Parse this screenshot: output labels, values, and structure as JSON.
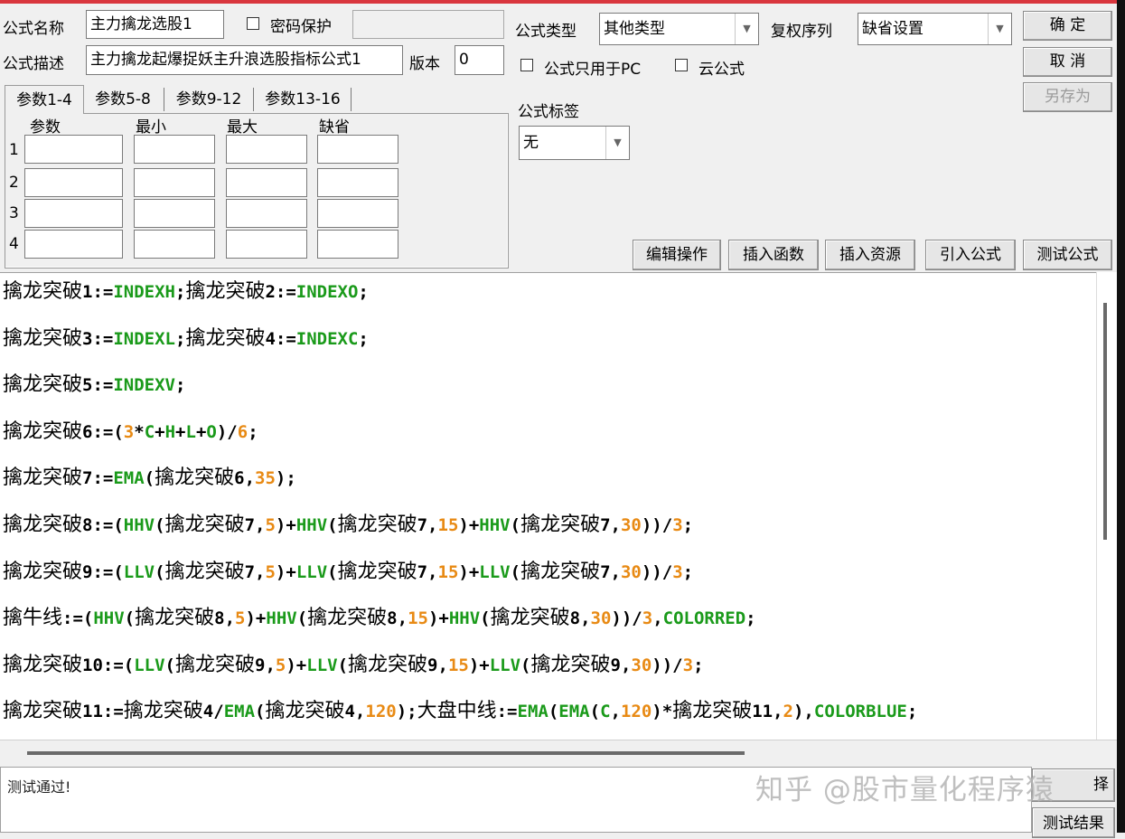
{
  "form": {
    "name_label": "公式名称",
    "name_value": "主力擒龙选股1",
    "password_label": "密码保护",
    "password_value": "",
    "desc_label": "公式描述",
    "desc_value": "主力擒龙起爆捉妖主升浪选股指标公式1",
    "version_label": "版本",
    "version_value": "0",
    "type_label": "公式类型",
    "type_value": "其他类型",
    "rights_label": "复权序列",
    "rights_value": "缺省设置",
    "pc_only_label": "公式只用于PC",
    "cloud_label": "云公式",
    "tag_label": "公式标签",
    "tag_value": "无"
  },
  "buttons": {
    "ok": "确  定",
    "cancel": "取  消",
    "save_as": "另存为",
    "edit_ops": "编辑操作",
    "insert_func": "插入函数",
    "insert_res": "插入资源",
    "import_formula": "引入公式",
    "test_formula": "测试公式",
    "select_partial": "择",
    "test_result": "测试结果"
  },
  "tabs": [
    "参数1-4",
    "参数5-8",
    "参数9-12",
    "参数13-16"
  ],
  "params": {
    "headers": [
      "参数",
      "最小",
      "最大",
      "缺省"
    ],
    "rows": [
      "1",
      "2",
      "3",
      "4"
    ]
  },
  "code": [
    [
      [
        "cjk",
        "擒龙突破"
      ],
      [
        "t",
        "1:="
      ],
      [
        "fn",
        "INDEXH"
      ],
      [
        "t",
        ";"
      ],
      [
        "cjk",
        "擒龙突破"
      ],
      [
        "t",
        "2:="
      ],
      [
        "fn",
        "INDEXO"
      ],
      [
        "t",
        ";"
      ]
    ],
    [
      [
        "cjk",
        "擒龙突破"
      ],
      [
        "t",
        "3:="
      ],
      [
        "fn",
        "INDEXL"
      ],
      [
        "t",
        ";"
      ],
      [
        "cjk",
        "擒龙突破"
      ],
      [
        "t",
        "4:="
      ],
      [
        "fn",
        "INDEXC"
      ],
      [
        "t",
        ";"
      ]
    ],
    [
      [
        "cjk",
        "擒龙突破"
      ],
      [
        "t",
        "5:="
      ],
      [
        "fn",
        "INDEXV"
      ],
      [
        "t",
        ";"
      ]
    ],
    [
      [
        "cjk",
        "擒龙突破"
      ],
      [
        "t",
        "6:=("
      ],
      [
        "num",
        "3"
      ],
      [
        "t",
        "*"
      ],
      [
        "fn",
        "C"
      ],
      [
        "t",
        "+"
      ],
      [
        "fn",
        "H"
      ],
      [
        "t",
        "+"
      ],
      [
        "fn",
        "L"
      ],
      [
        "t",
        "+"
      ],
      [
        "fn",
        "O"
      ],
      [
        "t",
        ")/"
      ],
      [
        "num",
        "6"
      ],
      [
        "t",
        ";"
      ]
    ],
    [
      [
        "cjk",
        "擒龙突破"
      ],
      [
        "t",
        "7:="
      ],
      [
        "fn",
        "EMA"
      ],
      [
        "t",
        "("
      ],
      [
        "cjk",
        "擒龙突破"
      ],
      [
        "t",
        "6,"
      ],
      [
        "num",
        "35"
      ],
      [
        "t",
        ");"
      ]
    ],
    [
      [
        "cjk",
        "擒龙突破"
      ],
      [
        "t",
        "8:=("
      ],
      [
        "fn",
        "HHV"
      ],
      [
        "t",
        "("
      ],
      [
        "cjk",
        "擒龙突破"
      ],
      [
        "t",
        "7,"
      ],
      [
        "num",
        "5"
      ],
      [
        "t",
        ")+"
      ],
      [
        "fn",
        "HHV"
      ],
      [
        "t",
        "("
      ],
      [
        "cjk",
        "擒龙突破"
      ],
      [
        "t",
        "7,"
      ],
      [
        "num",
        "15"
      ],
      [
        "t",
        ")+"
      ],
      [
        "fn",
        "HHV"
      ],
      [
        "t",
        "("
      ],
      [
        "cjk",
        "擒龙突破"
      ],
      [
        "t",
        "7,"
      ],
      [
        "num",
        "30"
      ],
      [
        "t",
        "))/"
      ],
      [
        "num",
        "3"
      ],
      [
        "t",
        ";"
      ]
    ],
    [
      [
        "cjk",
        "擒龙突破"
      ],
      [
        "t",
        "9:=("
      ],
      [
        "fn",
        "LLV"
      ],
      [
        "t",
        "("
      ],
      [
        "cjk",
        "擒龙突破"
      ],
      [
        "t",
        "7,"
      ],
      [
        "num",
        "5"
      ],
      [
        "t",
        ")+"
      ],
      [
        "fn",
        "LLV"
      ],
      [
        "t",
        "("
      ],
      [
        "cjk",
        "擒龙突破"
      ],
      [
        "t",
        "7,"
      ],
      [
        "num",
        "15"
      ],
      [
        "t",
        ")+"
      ],
      [
        "fn",
        "LLV"
      ],
      [
        "t",
        "("
      ],
      [
        "cjk",
        "擒龙突破"
      ],
      [
        "t",
        "7,"
      ],
      [
        "num",
        "30"
      ],
      [
        "t",
        "))/"
      ],
      [
        "num",
        "3"
      ],
      [
        "t",
        ";"
      ]
    ],
    [
      [
        "cjk",
        "擒牛线"
      ],
      [
        "t",
        ":=("
      ],
      [
        "fn",
        "HHV"
      ],
      [
        "t",
        "("
      ],
      [
        "cjk",
        "擒龙突破"
      ],
      [
        "t",
        "8,"
      ],
      [
        "num",
        "5"
      ],
      [
        "t",
        ")+"
      ],
      [
        "fn",
        "HHV"
      ],
      [
        "t",
        "("
      ],
      [
        "cjk",
        "擒龙突破"
      ],
      [
        "t",
        "8,"
      ],
      [
        "num",
        "15"
      ],
      [
        "t",
        ")+"
      ],
      [
        "fn",
        "HHV"
      ],
      [
        "t",
        "("
      ],
      [
        "cjk",
        "擒龙突破"
      ],
      [
        "t",
        "8,"
      ],
      [
        "num",
        "30"
      ],
      [
        "t",
        "))/"
      ],
      [
        "num",
        "3"
      ],
      [
        "t",
        ","
      ],
      [
        "fn",
        "COLORRED"
      ],
      [
        "t",
        ";"
      ]
    ],
    [
      [
        "cjk",
        "擒龙突破"
      ],
      [
        "t",
        "10:=("
      ],
      [
        "fn",
        "LLV"
      ],
      [
        "t",
        "("
      ],
      [
        "cjk",
        "擒龙突破"
      ],
      [
        "t",
        "9,"
      ],
      [
        "num",
        "5"
      ],
      [
        "t",
        ")+"
      ],
      [
        "fn",
        "LLV"
      ],
      [
        "t",
        "("
      ],
      [
        "cjk",
        "擒龙突破"
      ],
      [
        "t",
        "9,"
      ],
      [
        "num",
        "15"
      ],
      [
        "t",
        ")+"
      ],
      [
        "fn",
        "LLV"
      ],
      [
        "t",
        "("
      ],
      [
        "cjk",
        "擒龙突破"
      ],
      [
        "t",
        "9,"
      ],
      [
        "num",
        "30"
      ],
      [
        "t",
        "))/"
      ],
      [
        "num",
        "3"
      ],
      [
        "t",
        ";"
      ]
    ],
    [
      [
        "cjk",
        "擒龙突破"
      ],
      [
        "t",
        "11:="
      ],
      [
        "cjk",
        "擒龙突破"
      ],
      [
        "t",
        "4/"
      ],
      [
        "fn",
        "EMA"
      ],
      [
        "t",
        "("
      ],
      [
        "cjk",
        "擒龙突破"
      ],
      [
        "t",
        "4,"
      ],
      [
        "num",
        "120"
      ],
      [
        "t",
        ");"
      ],
      [
        "cjk",
        "大盘中线"
      ],
      [
        "t",
        ":="
      ],
      [
        "fn",
        "EMA"
      ],
      [
        "t",
        "("
      ],
      [
        "fn",
        "EMA"
      ],
      [
        "t",
        "("
      ],
      [
        "fn",
        "C"
      ],
      [
        "t",
        ","
      ],
      [
        "num",
        "120"
      ],
      [
        "t",
        ")*"
      ],
      [
        "cjk",
        "擒龙突破"
      ],
      [
        "t",
        "11,"
      ],
      [
        "num",
        "2"
      ],
      [
        "t",
        "),"
      ],
      [
        "fn",
        "COLORBLUE"
      ],
      [
        "t",
        ";"
      ]
    ]
  ],
  "result_text": "测试通过!",
  "watermark": "知乎 @股市量化程序猿",
  "colors": {
    "function": "#1a9a1a",
    "number": "#e88a14",
    "title_bar": "#d9363e"
  }
}
